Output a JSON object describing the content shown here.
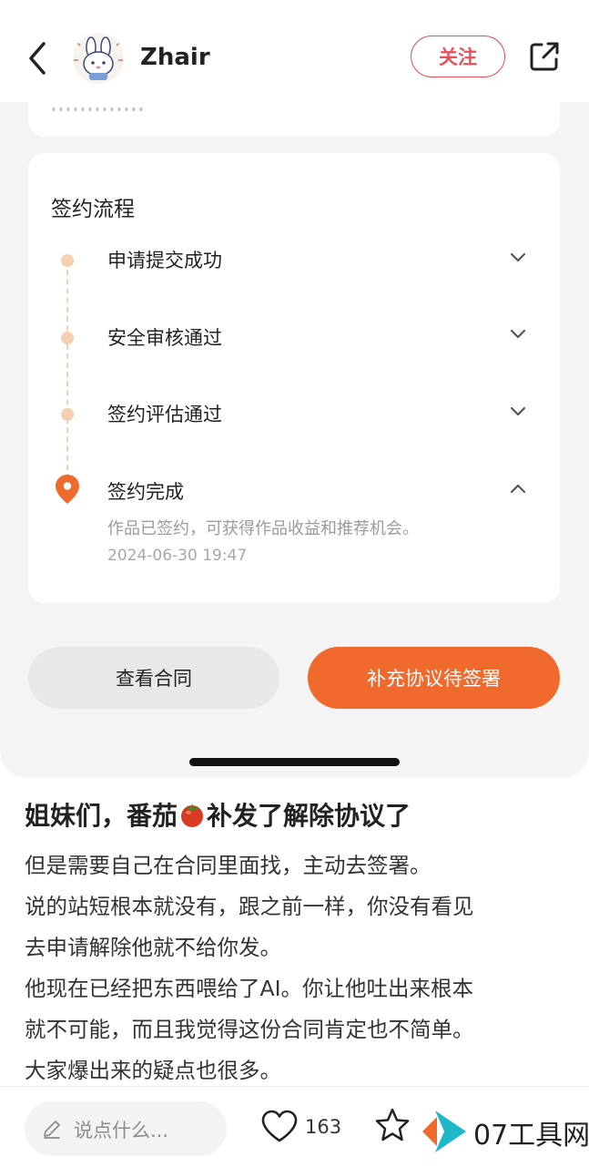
{
  "header": {
    "username": "Zhair",
    "follow_label": "关注"
  },
  "signing": {
    "title": "签约流程",
    "steps": [
      {
        "label": "申请提交成功",
        "state": "done"
      },
      {
        "label": "安全审核通过",
        "state": "done"
      },
      {
        "label": "签约评估通过",
        "state": "done"
      },
      {
        "label": "签约完成",
        "state": "current",
        "description": "作品已签约，可获得作品收益和推荐机会。",
        "time": "2024-06-30 19:47"
      }
    ],
    "view_contract_label": "查看合同",
    "supplement_label": "补充协议待签署"
  },
  "post": {
    "title_before": "姐妹们，番茄",
    "title_after": "补发了解除协议了",
    "lines": [
      "但是需要自己在合同里面找，主动去签署。",
      "说的站短根本就没有，跟之前一样，你没有看见",
      "去申请解除他就不给你发。",
      "他现在已经把东西喂给了AI。你让他吐出来根本",
      "就不可能，而且我觉得这份合同肯定也不简单。",
      "大家爆出来的疑点也很多。"
    ]
  },
  "bottom": {
    "comment_placeholder": "说点什么...",
    "like_count": "163",
    "watermark": "07工具网"
  },
  "colors": {
    "accent": "#ef6a2c",
    "follow": "#e8505b",
    "timeline_dot": "#f5cfb2"
  }
}
